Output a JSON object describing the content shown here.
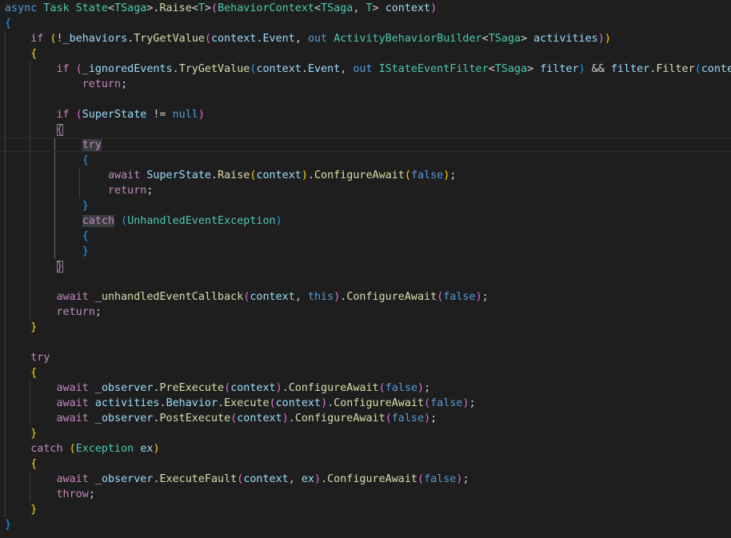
{
  "editor": {
    "theme": "dark",
    "colors": {
      "background": "#1e1e1e",
      "keyword": "#569cd6",
      "control": "#c586c0",
      "type": "#4ec9b0",
      "function": "#dcdcaa",
      "variable": "#9cdcfe",
      "text": "#d4d4d4",
      "brace_level1": "#179fff",
      "brace_level2": "#ffd700",
      "brace_level3": "#da70d6"
    },
    "lines": [
      [
        [
          "kw",
          "async"
        ],
        [
          "p",
          " "
        ],
        [
          "type",
          "Task"
        ],
        [
          "p",
          " "
        ],
        [
          "type",
          "State"
        ],
        [
          "p",
          "<"
        ],
        [
          "type",
          "TSaga"
        ],
        [
          "p",
          ">."
        ],
        [
          "fn",
          "Raise"
        ],
        [
          "p",
          "<"
        ],
        [
          "type",
          "T"
        ],
        [
          "p",
          ">"
        ],
        [
          "b3",
          "("
        ],
        [
          "type",
          "BehaviorContext"
        ],
        [
          "p",
          "<"
        ],
        [
          "type",
          "TSaga"
        ],
        [
          "p",
          ", "
        ],
        [
          "type",
          "T"
        ],
        [
          "p",
          "> "
        ],
        [
          "var",
          "context"
        ],
        [
          "b3",
          ")"
        ]
      ],
      [
        [
          "b1",
          "{"
        ]
      ],
      [
        [
          "p",
          "    "
        ],
        [
          "ctl",
          "if"
        ],
        [
          "p",
          " "
        ],
        [
          "b2",
          "("
        ],
        [
          "p",
          "!_"
        ],
        [
          "var",
          "behaviors"
        ],
        [
          "p",
          "."
        ],
        [
          "fn",
          "TryGetValue"
        ],
        [
          "b3",
          "("
        ],
        [
          "var",
          "context"
        ],
        [
          "p",
          "."
        ],
        [
          "var",
          "Event"
        ],
        [
          "p",
          ", "
        ],
        [
          "kw",
          "out"
        ],
        [
          "p",
          " "
        ],
        [
          "type",
          "ActivityBehaviorBuilder"
        ],
        [
          "p",
          "<"
        ],
        [
          "type",
          "TSaga"
        ],
        [
          "p",
          "> "
        ],
        [
          "var",
          "activities"
        ],
        [
          "b3",
          ")"
        ],
        [
          "b2",
          ")"
        ]
      ],
      [
        [
          "p",
          "    "
        ],
        [
          "b2",
          "{"
        ]
      ],
      [
        [
          "p",
          "        "
        ],
        [
          "ctl",
          "if"
        ],
        [
          "p",
          " "
        ],
        [
          "b3",
          "("
        ],
        [
          "p",
          "_"
        ],
        [
          "var",
          "ignoredEvents"
        ],
        [
          "p",
          "."
        ],
        [
          "fn",
          "TryGetValue"
        ],
        [
          "b1",
          "("
        ],
        [
          "var",
          "context"
        ],
        [
          "p",
          "."
        ],
        [
          "var",
          "Event"
        ],
        [
          "p",
          ", "
        ],
        [
          "kw",
          "out"
        ],
        [
          "p",
          " "
        ],
        [
          "type",
          "IStateEventFilter"
        ],
        [
          "p",
          "<"
        ],
        [
          "type",
          "TSaga"
        ],
        [
          "p",
          "> "
        ],
        [
          "var",
          "filter"
        ],
        [
          "b1",
          ")"
        ],
        [
          "p",
          " && "
        ],
        [
          "var",
          "filter"
        ],
        [
          "p",
          "."
        ],
        [
          "fn",
          "Filter"
        ],
        [
          "b1",
          "("
        ],
        [
          "var",
          "context"
        ],
        [
          "b1",
          ")"
        ],
        [
          "b3",
          ")"
        ]
      ],
      [
        [
          "p",
          "            "
        ],
        [
          "ctl",
          "return"
        ],
        [
          "p",
          ";"
        ]
      ],
      [
        [
          "p",
          ""
        ]
      ],
      [
        [
          "p",
          "        "
        ],
        [
          "ctl",
          "if"
        ],
        [
          "p",
          " "
        ],
        [
          "b3",
          "("
        ],
        [
          "var",
          "SuperState"
        ],
        [
          "p",
          " != "
        ],
        [
          "kw",
          "null"
        ],
        [
          "b3",
          ")"
        ]
      ],
      [
        [
          "p",
          "        "
        ],
        [
          "b3box",
          "{"
        ]
      ],
      [
        [
          "p",
          "            "
        ],
        [
          "ctlhl",
          "try"
        ]
      ],
      [
        [
          "p",
          "            "
        ],
        [
          "b1",
          "{"
        ]
      ],
      [
        [
          "p",
          "                "
        ],
        [
          "ctl",
          "await"
        ],
        [
          "p",
          " "
        ],
        [
          "var",
          "SuperState"
        ],
        [
          "p",
          "."
        ],
        [
          "fn",
          "Raise"
        ],
        [
          "b2",
          "("
        ],
        [
          "var",
          "context"
        ],
        [
          "b2",
          ")"
        ],
        [
          "p",
          "."
        ],
        [
          "fn",
          "ConfigureAwait"
        ],
        [
          "b2",
          "("
        ],
        [
          "kw",
          "false"
        ],
        [
          "b2",
          ")"
        ],
        [
          "p",
          ";"
        ]
      ],
      [
        [
          "p",
          "                "
        ],
        [
          "ctl",
          "return"
        ],
        [
          "p",
          ";"
        ]
      ],
      [
        [
          "p",
          "            "
        ],
        [
          "b1",
          "}"
        ]
      ],
      [
        [
          "p",
          "            "
        ],
        [
          "ctlhl",
          "catch"
        ],
        [
          "p",
          " "
        ],
        [
          "b1",
          "("
        ],
        [
          "type",
          "UnhandledEventException"
        ],
        [
          "b1",
          ")"
        ]
      ],
      [
        [
          "p",
          "            "
        ],
        [
          "b1",
          "{"
        ]
      ],
      [
        [
          "p",
          "            "
        ],
        [
          "b1",
          "}"
        ]
      ],
      [
        [
          "p",
          "        "
        ],
        [
          "b3box",
          "}"
        ]
      ],
      [
        [
          "p",
          ""
        ]
      ],
      [
        [
          "p",
          "        "
        ],
        [
          "ctl",
          "await"
        ],
        [
          "p",
          " _"
        ],
        [
          "fn",
          "unhandledEventCallback"
        ],
        [
          "b3",
          "("
        ],
        [
          "var",
          "context"
        ],
        [
          "p",
          ", "
        ],
        [
          "kw",
          "this"
        ],
        [
          "b3",
          ")"
        ],
        [
          "p",
          "."
        ],
        [
          "fn",
          "ConfigureAwait"
        ],
        [
          "b3",
          "("
        ],
        [
          "kw",
          "false"
        ],
        [
          "b3",
          ")"
        ],
        [
          "p",
          ";"
        ]
      ],
      [
        [
          "p",
          "        "
        ],
        [
          "ctl",
          "return"
        ],
        [
          "p",
          ";"
        ]
      ],
      [
        [
          "p",
          "    "
        ],
        [
          "b2",
          "}"
        ]
      ],
      [
        [
          "p",
          ""
        ]
      ],
      [
        [
          "p",
          "    "
        ],
        [
          "ctl",
          "try"
        ]
      ],
      [
        [
          "p",
          "    "
        ],
        [
          "b2",
          "{"
        ]
      ],
      [
        [
          "p",
          "        "
        ],
        [
          "ctl",
          "await"
        ],
        [
          "p",
          " _"
        ],
        [
          "var",
          "observer"
        ],
        [
          "p",
          "."
        ],
        [
          "fn",
          "PreExecute"
        ],
        [
          "b3",
          "("
        ],
        [
          "var",
          "context"
        ],
        [
          "b3",
          ")"
        ],
        [
          "p",
          "."
        ],
        [
          "fn",
          "ConfigureAwait"
        ],
        [
          "b3",
          "("
        ],
        [
          "kw",
          "false"
        ],
        [
          "b3",
          ")"
        ],
        [
          "p",
          ";"
        ]
      ],
      [
        [
          "p",
          "        "
        ],
        [
          "ctl",
          "await"
        ],
        [
          "p",
          " "
        ],
        [
          "var",
          "activities"
        ],
        [
          "p",
          "."
        ],
        [
          "var",
          "Behavior"
        ],
        [
          "p",
          "."
        ],
        [
          "fn",
          "Execute"
        ],
        [
          "b3",
          "("
        ],
        [
          "var",
          "context"
        ],
        [
          "b3",
          ")"
        ],
        [
          "p",
          "."
        ],
        [
          "fn",
          "ConfigureAwait"
        ],
        [
          "b3",
          "("
        ],
        [
          "kw",
          "false"
        ],
        [
          "b3",
          ")"
        ],
        [
          "p",
          ";"
        ]
      ],
      [
        [
          "p",
          "        "
        ],
        [
          "ctl",
          "await"
        ],
        [
          "p",
          " _"
        ],
        [
          "var",
          "observer"
        ],
        [
          "p",
          "."
        ],
        [
          "fn",
          "PostExecute"
        ],
        [
          "b3",
          "("
        ],
        [
          "var",
          "context"
        ],
        [
          "b3",
          ")"
        ],
        [
          "p",
          "."
        ],
        [
          "fn",
          "ConfigureAwait"
        ],
        [
          "b3",
          "("
        ],
        [
          "kw",
          "false"
        ],
        [
          "b3",
          ")"
        ],
        [
          "p",
          ";"
        ]
      ],
      [
        [
          "p",
          "    "
        ],
        [
          "b2",
          "}"
        ]
      ],
      [
        [
          "p",
          "    "
        ],
        [
          "ctl",
          "catch"
        ],
        [
          "p",
          " "
        ],
        [
          "b2",
          "("
        ],
        [
          "type",
          "Exception"
        ],
        [
          "p",
          " "
        ],
        [
          "var",
          "ex"
        ],
        [
          "b2",
          ")"
        ]
      ],
      [
        [
          "p",
          "    "
        ],
        [
          "b2",
          "{"
        ]
      ],
      [
        [
          "p",
          "        "
        ],
        [
          "ctl",
          "await"
        ],
        [
          "p",
          " _"
        ],
        [
          "var",
          "observer"
        ],
        [
          "p",
          "."
        ],
        [
          "fn",
          "ExecuteFault"
        ],
        [
          "b3",
          "("
        ],
        [
          "var",
          "context"
        ],
        [
          "p",
          ", "
        ],
        [
          "var",
          "ex"
        ],
        [
          "b3",
          ")"
        ],
        [
          "p",
          "."
        ],
        [
          "fn",
          "ConfigureAwait"
        ],
        [
          "b3",
          "("
        ],
        [
          "kw",
          "false"
        ],
        [
          "b3",
          ")"
        ],
        [
          "p",
          ";"
        ]
      ],
      [
        [
          "p",
          "        "
        ],
        [
          "ctl",
          "throw"
        ],
        [
          "p",
          ";"
        ]
      ],
      [
        [
          "p",
          "    "
        ],
        [
          "b2",
          "}"
        ]
      ],
      [
        [
          "b1",
          "}"
        ]
      ]
    ]
  }
}
